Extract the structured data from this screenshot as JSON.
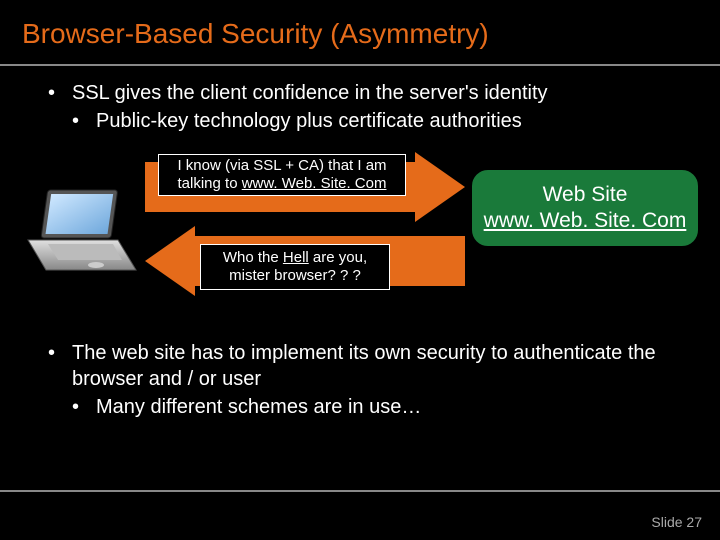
{
  "title": "Browser-Based Security (Asymmetry)",
  "bullet1": "SSL gives the client confidence in the server's identity",
  "bullet1_sub": "Public-key technology plus certificate authorities",
  "callout1_line1": "I know (via SSL + CA) that I am",
  "callout1_line2a": "talking to ",
  "callout1_line2b": "www. Web. Site. Com",
  "callout2_line1a": "Who the ",
  "callout2_line1b": "Hell",
  "callout2_line1c": " are you,",
  "callout2_line2": "mister browser? ? ?",
  "server_line1": "Web Site",
  "server_line2": "www. Web. Site. Com",
  "bullet2": "The web site has to implement its own security to authenticate the browser and / or user",
  "bullet2_sub": "Many different schemes are in use…",
  "footer": "Slide 27"
}
